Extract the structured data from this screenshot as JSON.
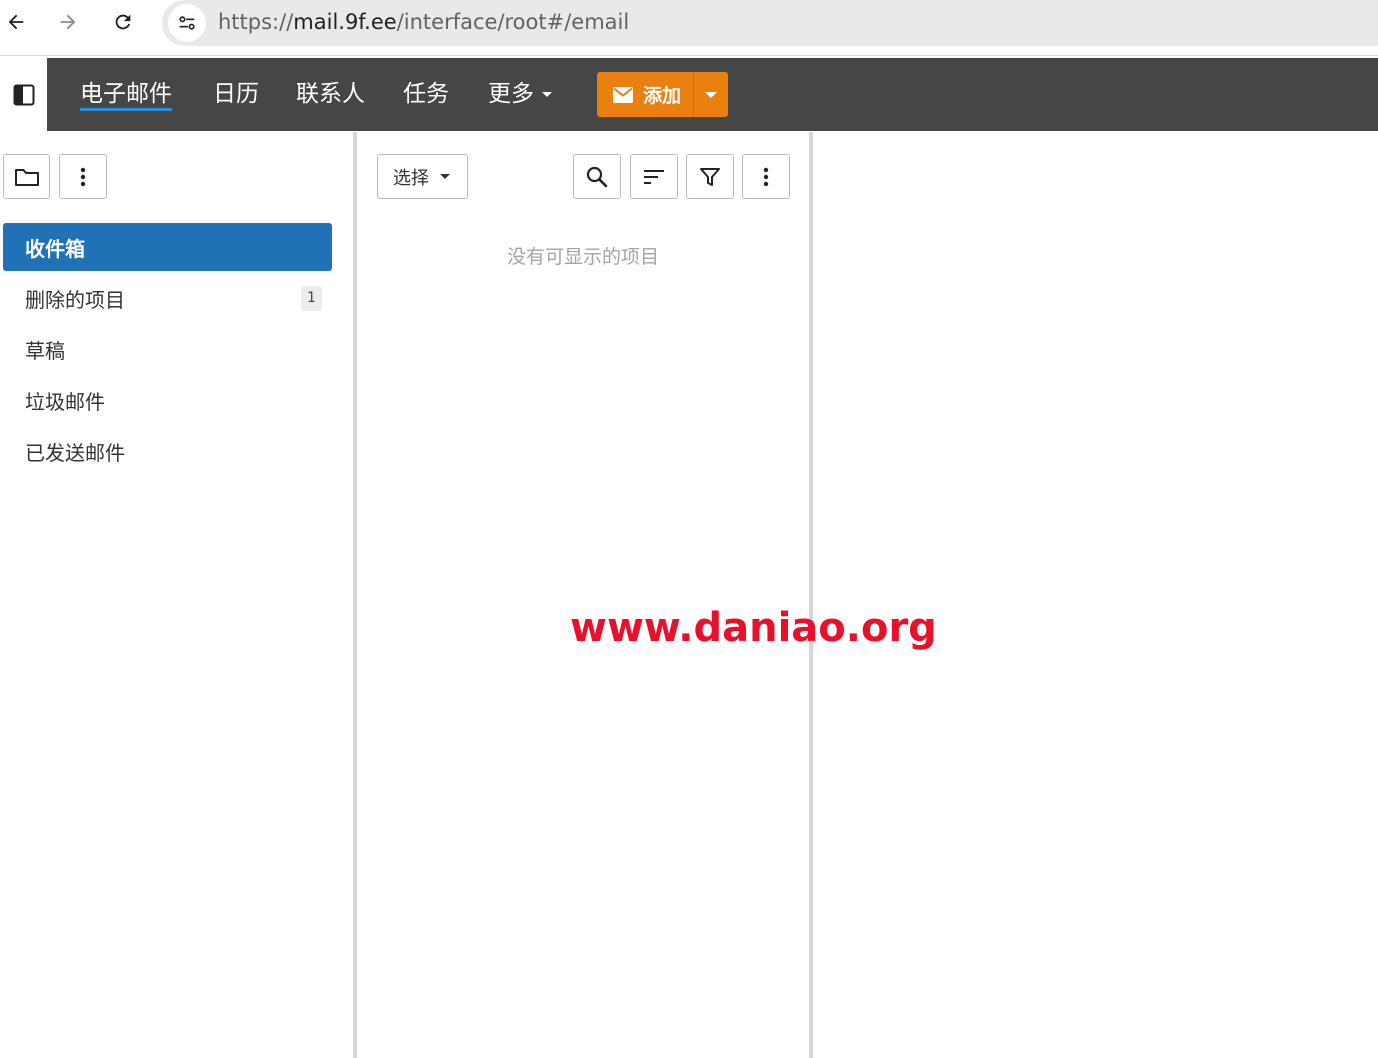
{
  "browser": {
    "url_prefix": "https://",
    "url_host": "mail.9f.ee",
    "url_path": "/interface/root#/email"
  },
  "nav": {
    "tabs": [
      {
        "label": "电子邮件",
        "active": true
      },
      {
        "label": "日历",
        "active": false
      },
      {
        "label": "联系人",
        "active": false
      },
      {
        "label": "任务",
        "active": false
      },
      {
        "label": "更多",
        "active": false
      }
    ],
    "add_label": "添加"
  },
  "folders": {
    "items": [
      {
        "label": "收件箱",
        "selected": true
      },
      {
        "label": "删除的项目",
        "badge": "1"
      },
      {
        "label": "草稿"
      },
      {
        "label": "垃圾邮件"
      },
      {
        "label": "已发送邮件"
      }
    ]
  },
  "list": {
    "select_label": "选择",
    "empty_message": "没有可显示的项目"
  },
  "watermark": "www.daniao.org",
  "colors": {
    "app_bar": "#464646",
    "add_button": "#ea8010",
    "selected_folder": "#1e72b5",
    "active_tab_underline": "#2a8fdd",
    "watermark": "#e8102a"
  }
}
